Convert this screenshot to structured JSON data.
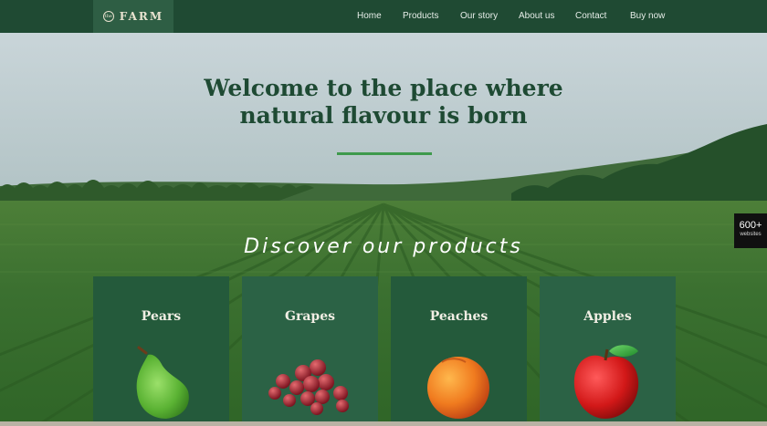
{
  "brand": {
    "name": "FARM",
    "badge_text": "the"
  },
  "nav": {
    "items": [
      {
        "label": "Home"
      },
      {
        "label": "Products"
      },
      {
        "label": "Our story"
      },
      {
        "label": "About us"
      },
      {
        "label": "Contact"
      },
      {
        "label": "Buy now"
      }
    ]
  },
  "hero": {
    "title_line1": "Welcome to the place where",
    "title_line2": "natural flavour is born",
    "discover": "Discover our products"
  },
  "badge": {
    "count": "600+",
    "label": "websites"
  },
  "products": [
    {
      "name": "Pears",
      "icon": "pear-icon"
    },
    {
      "name": "Grapes",
      "icon": "grapes-icon"
    },
    {
      "name": "Peaches",
      "icon": "peach-icon"
    },
    {
      "name": "Apples",
      "icon": "apple-icon"
    }
  ],
  "colors": {
    "nav_bg": "#1f4a33",
    "accent": "#3e9a4c",
    "card_bg": "#245a3b",
    "title_text": "#1e4a33"
  }
}
